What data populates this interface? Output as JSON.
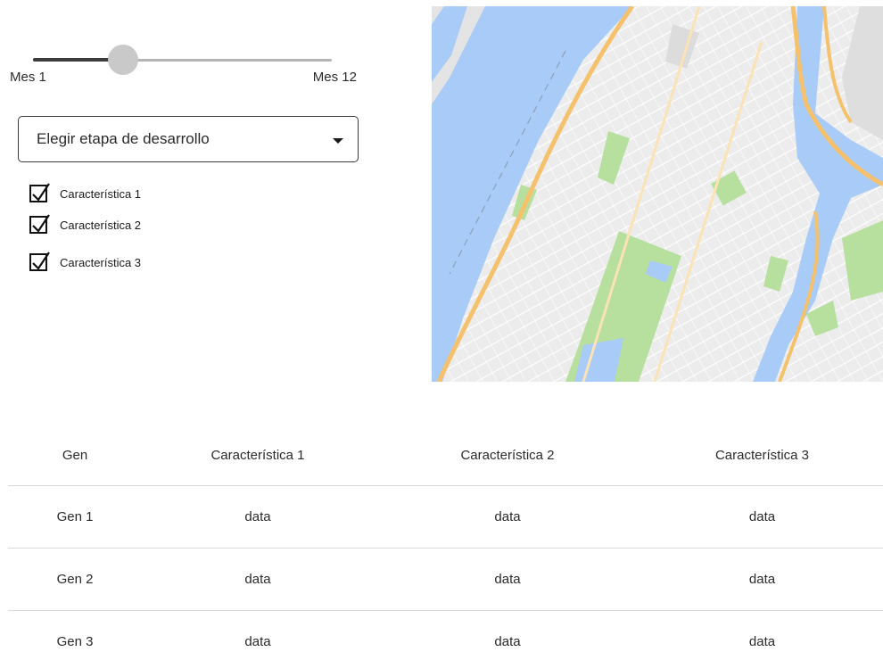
{
  "slider": {
    "min_label": "Mes 1",
    "max_label": "Mes 12",
    "value_fraction": 0.3
  },
  "dropdown": {
    "label": "Elegir etapa de desarrollo"
  },
  "checkboxes": [
    {
      "label": "Característica 1",
      "checked": true
    },
    {
      "label": "Característica 2",
      "checked": true
    },
    {
      "label": "Característica 3",
      "checked": true
    }
  ],
  "table": {
    "headers": [
      "Gen",
      "Característica 1",
      "Característica 2",
      "Característica 3"
    ],
    "rows": [
      [
        "Gen 1",
        "data",
        "data",
        "data"
      ],
      [
        "Gen 2",
        "data",
        "data",
        "data"
      ],
      [
        "Gen 3",
        "data",
        "data",
        "data"
      ]
    ]
  },
  "colors": {
    "water": "#a9cbf7",
    "park": "#b7df9e",
    "highway": "#f5c16c",
    "land": "#eeeeee"
  }
}
